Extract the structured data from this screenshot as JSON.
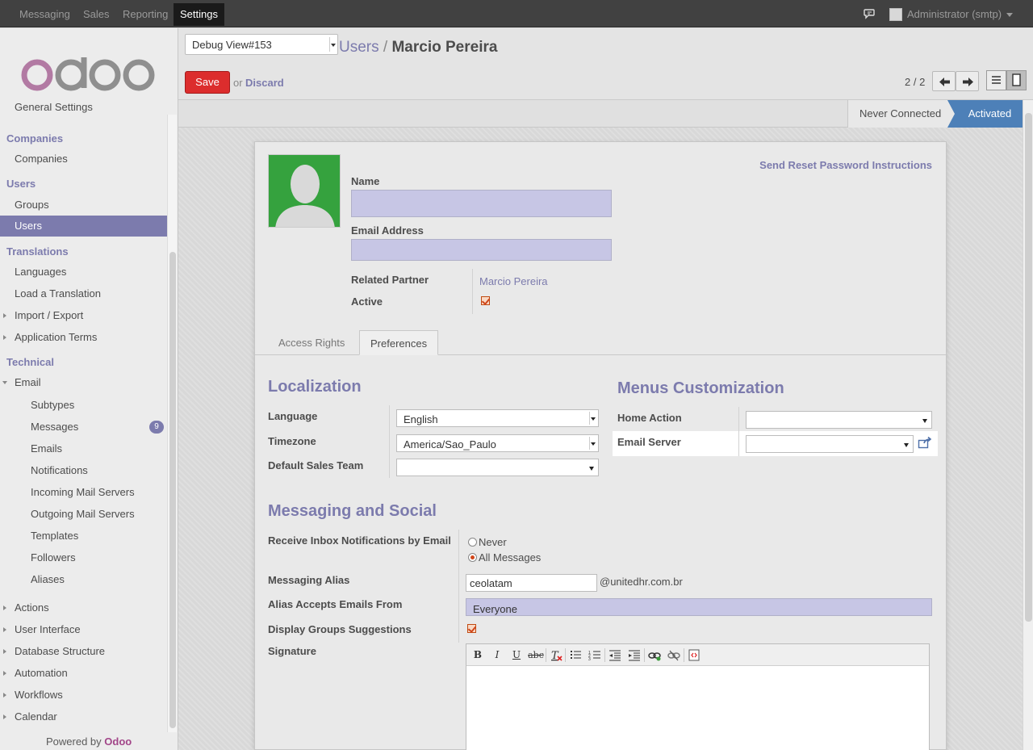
{
  "topbar": {
    "menus": [
      "Messaging",
      "Sales",
      "Reporting",
      "Settings"
    ],
    "active_menu": "Settings",
    "user": "Administrator (smtp)"
  },
  "sidebar": {
    "partial_item": "General Settings",
    "headers": {
      "companies": "Companies",
      "users": "Users",
      "translations": "Translations",
      "technical": "Technical"
    },
    "items": {
      "companies": "Companies",
      "groups": "Groups",
      "users": "Users",
      "languages": "Languages",
      "load_translation": "Load a Translation",
      "import_export": "Import / Export",
      "app_terms": "Application Terms",
      "email": "Email",
      "subtypes": "Subtypes",
      "messages": "Messages",
      "messages_count": "9",
      "emails": "Emails",
      "notifications": "Notifications",
      "incoming": "Incoming Mail Servers",
      "outgoing": "Outgoing Mail Servers",
      "templates": "Templates",
      "followers": "Followers",
      "aliases": "Aliases",
      "actions": "Actions",
      "user_interface": "User Interface",
      "db_structure": "Database Structure",
      "automation": "Automation",
      "workflows": "Workflows",
      "calendar": "Calendar"
    },
    "powered_prefix": "Powered by",
    "powered_brand": "Odoo"
  },
  "header": {
    "debug_view": "Debug View#153",
    "breadcrumb_parent": "Users",
    "breadcrumb_sep": "/",
    "breadcrumb_current": "Marcio Pereira",
    "save": "Save",
    "or": "or",
    "discard": "Discard",
    "pager": "2 / 2"
  },
  "status": {
    "never": "Never Connected",
    "activated": "Activated"
  },
  "form": {
    "reset_link": "Send Reset Password Instructions",
    "name_label": "Name",
    "name_value": "",
    "email_label": "Email Address",
    "email_value": "",
    "related_partner_label": "Related Partner",
    "related_partner_value": "Marcio Pereira",
    "active_label": "Active",
    "active_checked": true,
    "tabs": [
      "Access Rights",
      "Preferences"
    ],
    "active_tab": "Preferences",
    "localization": {
      "title": "Localization",
      "language_label": "Language",
      "language_value": "English",
      "timezone_label": "Timezone",
      "timezone_value": "America/Sao_Paulo",
      "sales_team_label": "Default Sales Team",
      "sales_team_value": ""
    },
    "menus_customization": {
      "title": "Menus Customization",
      "home_action_label": "Home Action",
      "home_action_value": "",
      "email_server_label": "Email Server",
      "email_server_value": ""
    },
    "messaging": {
      "title": "Messaging and Social",
      "inbox_label": "Receive Inbox Notifications by Email",
      "opt_never": "Never",
      "opt_all": "All Messages",
      "selected": "All Messages",
      "alias_label": "Messaging Alias",
      "alias_value": "ceolatam",
      "alias_domain": "@unitedhr.com.br",
      "alias_from_label": "Alias Accepts Emails From",
      "alias_from_value": "Everyone",
      "groups_label": "Display Groups Suggestions",
      "groups_checked": true,
      "signature_label": "Signature"
    }
  },
  "colors": {
    "accent": "#7c7bad",
    "brand": "#a24689",
    "save": "#dc2d2d",
    "status_active": "#4d80b8"
  }
}
